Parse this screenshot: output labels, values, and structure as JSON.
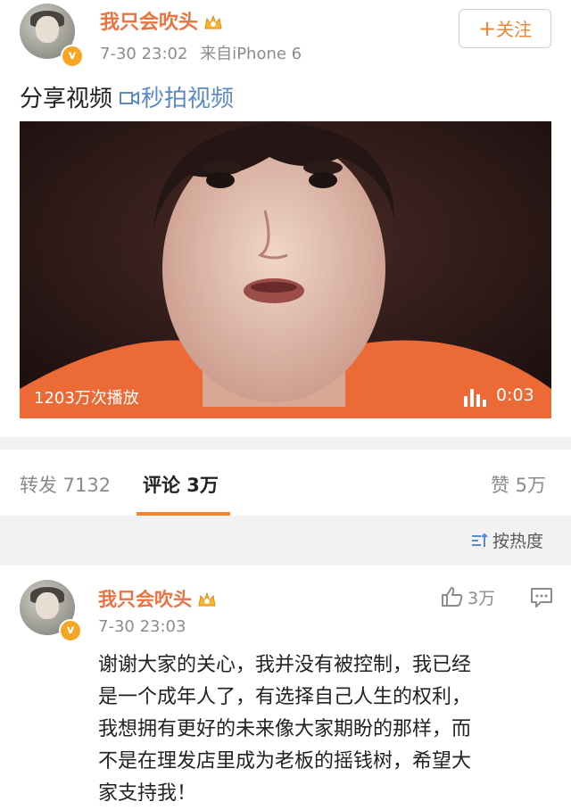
{
  "post": {
    "username": "我只会吹头",
    "timestamp": "7-30 23:02",
    "source": "来自iPhone 6",
    "follow_label": "关注",
    "text": "分享视频",
    "link_label": "秒拍视频",
    "video": {
      "plays": "1203万次播放",
      "duration": "0:03"
    }
  },
  "tabs": {
    "repost": "转发 7132",
    "comments": "评论 3万",
    "likes": "赞 5万"
  },
  "sort_label": "按热度",
  "comment": {
    "username": "我只会吹头",
    "timestamp": "7-30 23:03",
    "likes": "3万",
    "lines": [
      "谢谢大家的关心，我并没有被控制，我已经",
      "是一个成年人了，有选择自己人生的权利，",
      "我想拥有更好的未来像大家期盼的那样，而",
      "不是在理发店里成为老板的摇钱树，希望大",
      "家支持我！"
    ]
  },
  "colors": {
    "accent": "#eb7340",
    "link": "#5b8bc7",
    "follow": "#f08432",
    "badge": "#f6a623"
  }
}
